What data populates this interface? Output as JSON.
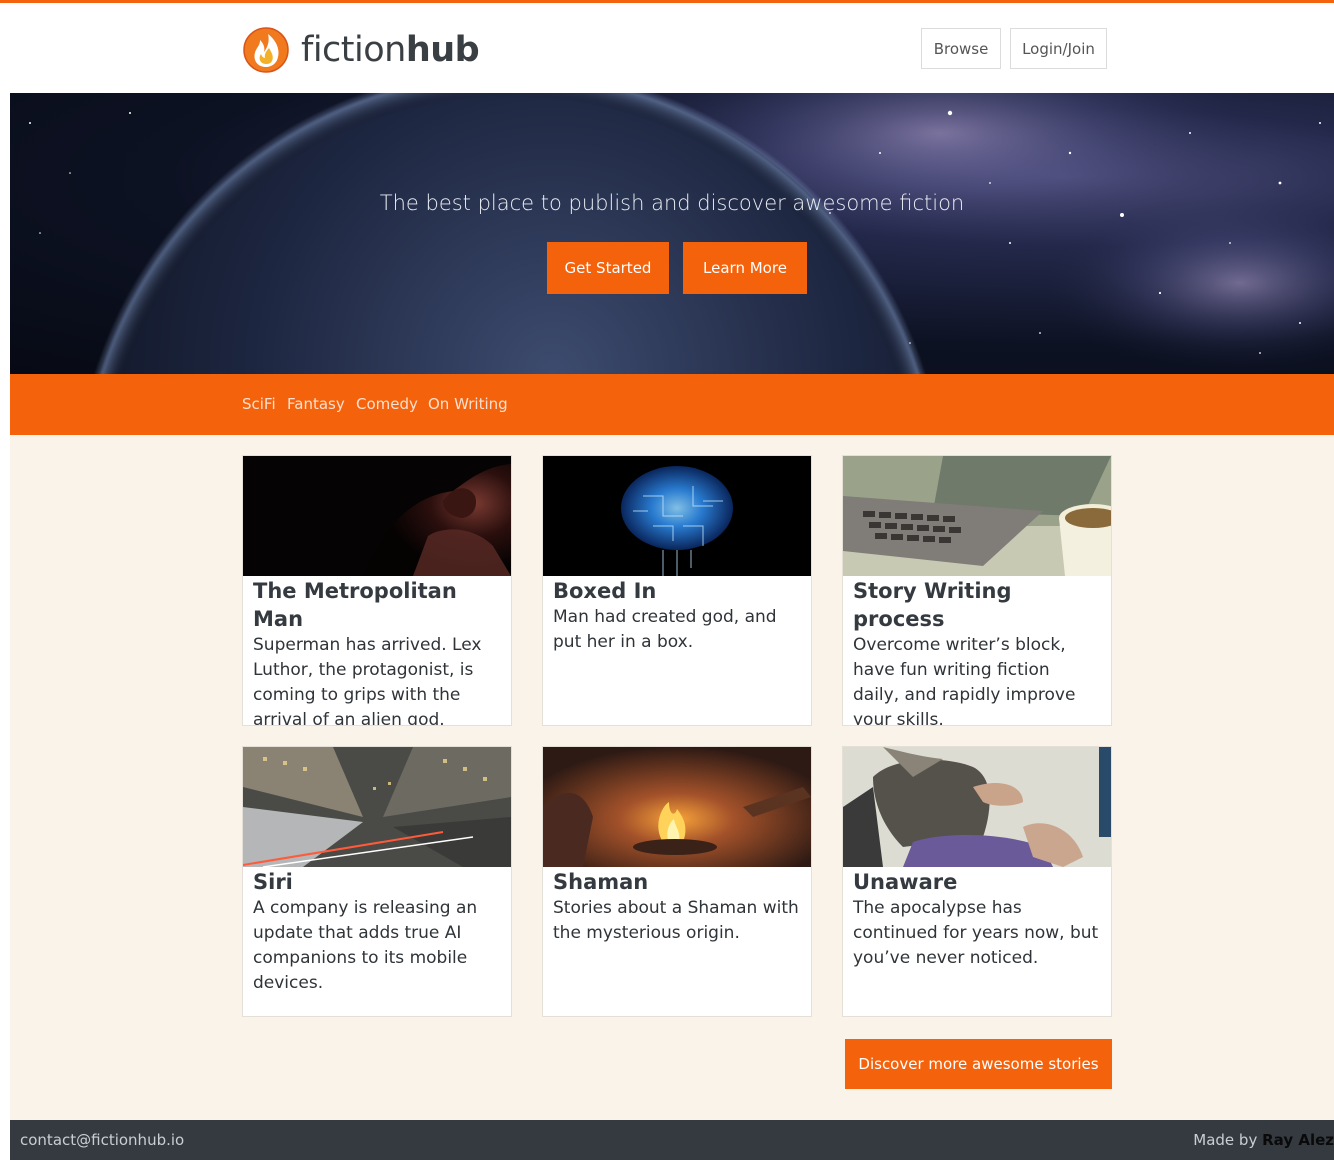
{
  "header": {
    "logo_text_light": "fiction",
    "logo_text_bold": "hub",
    "nav": {
      "browse": "Browse",
      "login": "Login/Join"
    }
  },
  "hero": {
    "tagline": "The best place to publish and discover awesome fiction",
    "get_started": "Get Started",
    "learn_more": "Learn More"
  },
  "categories": [
    "SciFi",
    "Fantasy",
    "Comedy",
    "On Writing"
  ],
  "stories": [
    {
      "title": "The Metropolitan Man",
      "description": "Superman has arrived. Lex Luthor, the protagonist, is coming to grips with the arrival of an alien god.",
      "image": "superman-silhouette"
    },
    {
      "title": "Boxed In",
      "description": "Man had created god, and put her in a box.",
      "image": "circuit-brain"
    },
    {
      "title": "Story Writing process",
      "description": "Overcome writer’s block, have fun writing fiction daily, and rapidly improve your skills.",
      "image": "laptop-and-coffee"
    },
    {
      "title": "Siri",
      "description": "A company is releasing an update that adds true AI companions to its mobile devices.",
      "image": "city-skyscrapers"
    },
    {
      "title": "Shaman",
      "description": "Stories about a Shaman with the mysterious origin.",
      "image": "campfire"
    },
    {
      "title": "Unaware",
      "description": "The apocalypse has continued for years now, but you’ve never noticed.",
      "image": "man-playing-game"
    }
  ],
  "discover_more": "Discover more awesome stories",
  "footer": {
    "contact": "contact@fictionhub.io",
    "made_by_prefix": "Made by",
    "made_by_name": "Ray Alez"
  },
  "colors": {
    "accent": "#f4620c",
    "content_bg": "#faf3e9",
    "footer_bg": "#343a40"
  }
}
